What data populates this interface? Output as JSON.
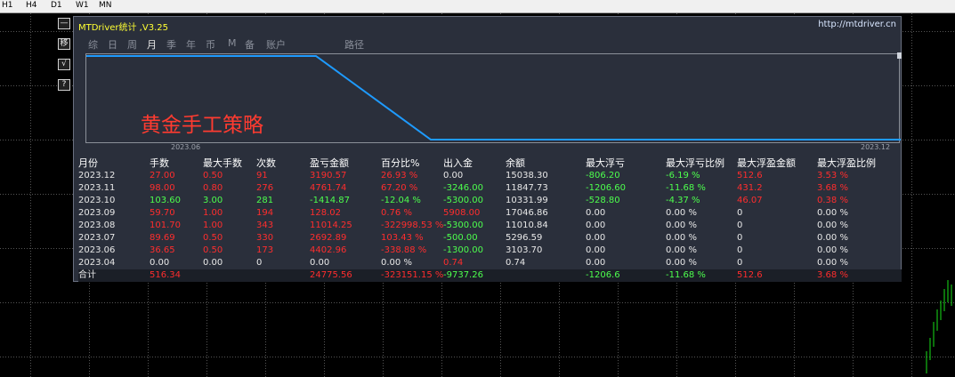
{
  "timeframes": [
    "H1",
    "H4",
    "D1",
    "W1",
    "MN"
  ],
  "side_buttons": [
    "—",
    "移",
    "√",
    "?"
  ],
  "panel": {
    "title": "MTDriver统计 ,V3.25",
    "url": "http://mtdriver.cn",
    "tabs": [
      "综",
      "日",
      "周",
      "月",
      "季",
      "年",
      "币",
      "M",
      "备",
      "账户",
      "路径"
    ],
    "active_tab_index": 3,
    "plot_label": "黄金手工策略",
    "x_start_label": "2023.06",
    "x_end_label": "2023.12"
  },
  "table": {
    "headers": [
      "月份",
      "手数",
      "最大手数",
      "次数",
      "盈亏金额",
      "百分比%",
      "出入金",
      "余额",
      "最大浮亏",
      "最大浮亏比例",
      "最大浮盈金额",
      "最大浮盈比例"
    ],
    "rows": [
      [
        "2023.12",
        "27.00",
        "0.50",
        "91",
        "3190.57",
        "26.93 %",
        "0.00",
        "15038.30",
        "-806.20",
        "-6.19 %",
        "512.6",
        "3.53 %"
      ],
      [
        "2023.11",
        "98.00",
        "0.80",
        "276",
        "4761.74",
        "67.20 %",
        "-3246.00",
        "11847.73",
        "-1206.60",
        "-11.68 %",
        "431.2",
        "3.68 %"
      ],
      [
        "2023.10",
        "103.60",
        "3.00",
        "281",
        "-1414.87",
        "-12.04 %",
        "-5300.00",
        "10331.99",
        "-528.80",
        "-4.37 %",
        "46.07",
        "0.38 %"
      ],
      [
        "2023.09",
        "59.70",
        "1.00",
        "194",
        "128.02",
        "0.76 %",
        "5908.00",
        "17046.86",
        "0.00",
        "0.00 %",
        "0",
        "0.00 %"
      ],
      [
        "2023.08",
        "101.70",
        "1.00",
        "343",
        "11014.25",
        "-322998.53 %",
        "-5300.00",
        "11010.84",
        "0.00",
        "0.00 %",
        "0",
        "0.00 %"
      ],
      [
        "2023.07",
        "89.69",
        "0.50",
        "330",
        "2692.89",
        "103.43 %",
        "-500.00",
        "5296.59",
        "0.00",
        "0.00 %",
        "0",
        "0.00 %"
      ],
      [
        "2023.06",
        "36.65",
        "0.50",
        "173",
        "4402.96",
        "-338.88 %",
        "-1300.00",
        "3103.70",
        "0.00",
        "0.00 %",
        "0",
        "0.00 %"
      ],
      [
        "2023.04",
        "0.00",
        "0.00",
        "0",
        "0.00",
        "0.00 %",
        "0.74",
        "0.74",
        "0.00",
        "0.00 %",
        "0",
        "0.00 %"
      ]
    ],
    "row_colors": [
      [
        "white",
        "red",
        "red",
        "red",
        "red",
        "red",
        "white",
        "white",
        "green",
        "green",
        "red",
        "red"
      ],
      [
        "white",
        "red",
        "red",
        "red",
        "red",
        "red",
        "green",
        "white",
        "green",
        "green",
        "red",
        "red"
      ],
      [
        "white",
        "green",
        "green",
        "green",
        "green",
        "green",
        "green",
        "white",
        "green",
        "green",
        "red",
        "red"
      ],
      [
        "white",
        "red",
        "red",
        "red",
        "red",
        "red",
        "red",
        "white",
        "white",
        "white",
        "white",
        "white"
      ],
      [
        "white",
        "red",
        "red",
        "red",
        "red",
        "red",
        "green",
        "white",
        "white",
        "white",
        "white",
        "white"
      ],
      [
        "white",
        "red",
        "red",
        "red",
        "red",
        "red",
        "green",
        "white",
        "white",
        "white",
        "white",
        "white"
      ],
      [
        "white",
        "red",
        "red",
        "red",
        "red",
        "red",
        "green",
        "white",
        "white",
        "white",
        "white",
        "white"
      ],
      [
        "white",
        "white",
        "white",
        "white",
        "white",
        "white",
        "red",
        "white",
        "white",
        "white",
        "white",
        "white"
      ]
    ],
    "total": {
      "label": "合计",
      "lots": "516.34",
      "profit": "24775.56",
      "percent": "-323151.15 %",
      "deposit": "-9737.26",
      "max_float_loss": "-1206.6",
      "max_float_loss_pct": "-11.68 %",
      "max_float_profit": "512.6",
      "max_float_profit_pct": "3.68 %"
    }
  },
  "colors": {
    "panel_bg": "#2a2f3b",
    "line": "#1e9bff",
    "title": "#ffff33",
    "red": "#ff2d2d",
    "green": "#4dff4d",
    "plot_label": "#ff3b30"
  }
}
